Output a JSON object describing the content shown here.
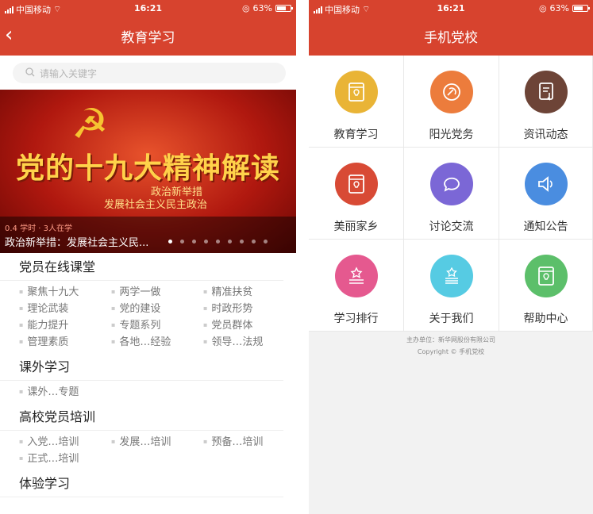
{
  "status": {
    "carrier": "中国移动",
    "time": "16:21",
    "battery": "63%"
  },
  "left": {
    "nav_title": "教育学习",
    "search_placeholder": "请输入关键字",
    "banner": {
      "title": "党的十九大精神解读",
      "sub1": "政治新举措",
      "sub2": "发展社会主义民主政治",
      "meta": "0.4 学时 · 3人在学",
      "caption": "政治新举措：发展社会主义民..."
    },
    "sections": [
      {
        "title": "党员在线课堂",
        "items": [
          "聚焦十九大",
          "两学一做",
          "精准扶贫",
          "理论武装",
          "党的建设",
          "时政形势",
          "能力提升",
          "专题系列",
          "党员群体",
          "管理素质",
          "各地…经验",
          "领导…法规"
        ]
      },
      {
        "title": "课外学习",
        "items": [
          "课外…专题"
        ]
      },
      {
        "title": "高校党员培训",
        "items": [
          "入党…培训",
          "发展…培训",
          "预备…培训",
          "正式…培训"
        ]
      },
      {
        "title": "体验学习",
        "items": []
      }
    ]
  },
  "right": {
    "nav_title": "手机党校",
    "tiles": [
      {
        "label": "教育学习",
        "color": "#e9b436",
        "icon": "book-icon"
      },
      {
        "label": "阳光党务",
        "color": "#ec7c3c",
        "icon": "emblem-icon"
      },
      {
        "label": "资讯动态",
        "color": "#6d4437",
        "icon": "news-icon"
      },
      {
        "label": "美丽家乡",
        "color": "#d84a35",
        "icon": "book-icon"
      },
      {
        "label": "讨论交流",
        "color": "#7b67d6",
        "icon": "chat-icon"
      },
      {
        "label": "通知公告",
        "color": "#4a8de0",
        "icon": "speaker-icon"
      },
      {
        "label": "学习排行",
        "color": "#e5598f",
        "icon": "rank-icon"
      },
      {
        "label": "关于我们",
        "color": "#56cbe3",
        "icon": "about-icon"
      },
      {
        "label": "帮助中心",
        "color": "#5cbf6a",
        "icon": "help-book-icon"
      }
    ],
    "footer_sponsor": "主办单位：新华网股份有限公司",
    "footer_copyright": "Copyright © 手机党校"
  }
}
